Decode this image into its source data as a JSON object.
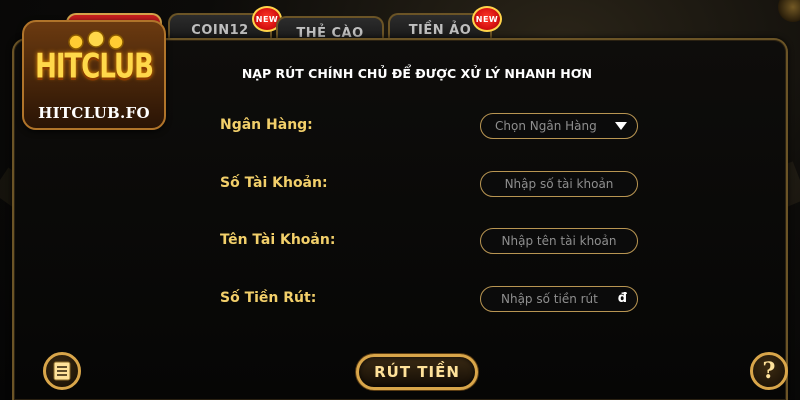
{
  "tabs": [
    {
      "label": "",
      "active": true,
      "new": false
    },
    {
      "label": "COIN12",
      "active": false,
      "new": true
    },
    {
      "label": "THẺ CÀO",
      "active": false,
      "new": false
    },
    {
      "label": "TIỀN ẢO",
      "active": false,
      "new": true
    }
  ],
  "badge_text": "NEW",
  "logo": {
    "word": "HITCLUB",
    "domain": "HITCLUB.FO"
  },
  "heading": "NẠP RÚT CHÍNH CHỦ ĐỂ ĐƯỢC XỬ LÝ NHANH HƠN",
  "form": {
    "bank": {
      "label": "Ngân Hàng:",
      "placeholder": "Chọn Ngân Hàng"
    },
    "account_number": {
      "label": "Số Tài Khoản:",
      "placeholder": "Nhập số tài  khoản"
    },
    "account_name": {
      "label": "Tên Tài Khoản:",
      "placeholder": "Nhập tên tài khoản"
    },
    "amount": {
      "label": "Số Tiền Rút:",
      "placeholder": "Nhập số tiền rút",
      "currency": "đ"
    }
  },
  "withdraw_button": "RÚT TIỀN",
  "help_glyph": "?",
  "icons": {
    "history": "history-list-icon",
    "help": "question-icon",
    "dropdown": "caret-down-icon"
  },
  "colors": {
    "gold": "#d9a64a",
    "label": "#f2cf6a",
    "active_tab": "#c81f1f",
    "background": "#0b0b0b"
  }
}
